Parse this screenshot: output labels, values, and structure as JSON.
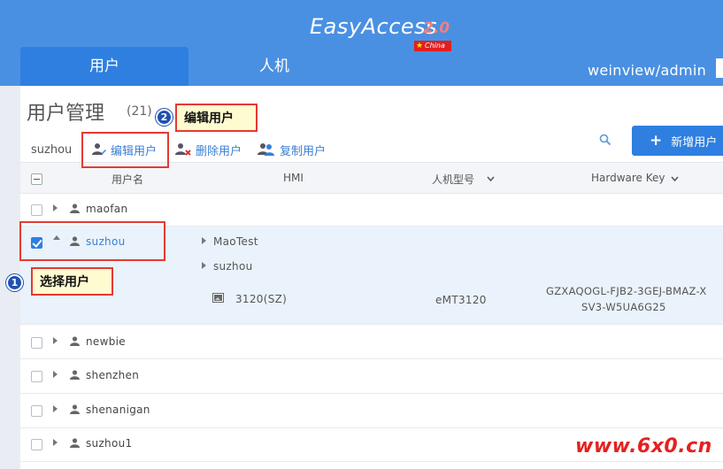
{
  "app": {
    "logo_main": "EasyAccess",
    "logo_version": "2.0",
    "logo_flag": "China"
  },
  "tabs": [
    {
      "label": "用户",
      "active": true
    },
    {
      "label": "人机",
      "active": false
    }
  ],
  "current_user": "weinview/admin",
  "page": {
    "title": "用户管理",
    "count": "(21)"
  },
  "toolbar": {
    "selected_user": "suzhou",
    "edit_label": "编辑用户",
    "delete_label": "删除用户",
    "copy_label": "复制用户",
    "new_label": "新增用户"
  },
  "table": {
    "headers": {
      "username": "用户名",
      "hmi": "HMI",
      "model": "人机型号",
      "hardware_key": "Hardware Key"
    },
    "rows": [
      {
        "name": "maofan",
        "checked": false,
        "expanded": false
      },
      {
        "name": "suzhou",
        "checked": true,
        "expanded": true,
        "groups": [
          "MaoTest",
          "suzhou"
        ],
        "device": {
          "name": "3120(SZ)",
          "model": "eMT3120",
          "key_line1": "GZXAQOGL-FJB2-3GEJ-BMAZ-X",
          "key_line2": "SV3-W5UA6G25"
        }
      },
      {
        "name": "newbie",
        "checked": false,
        "expanded": false
      },
      {
        "name": "shenzhen",
        "checked": false,
        "expanded": false
      },
      {
        "name": "shenanigan",
        "checked": false,
        "expanded": false
      },
      {
        "name": "suzhou1",
        "checked": false,
        "expanded": false
      }
    ]
  },
  "annotations": {
    "step1": {
      "number": "1",
      "label": "选择用户"
    },
    "step2": {
      "number": "2",
      "label": "编辑用户"
    }
  },
  "watermark": "www.6x0.cn",
  "colors": {
    "header_blue": "#4a90e2",
    "active_tab": "#2e7fe0",
    "link_blue": "#3a7fd5",
    "annotation_red": "#e53935",
    "callout_bg": "#fffbd0"
  }
}
